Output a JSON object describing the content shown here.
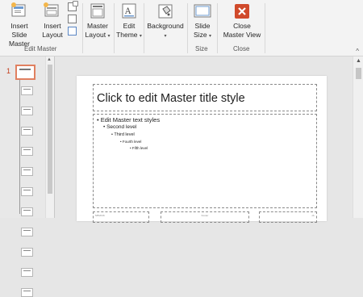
{
  "ribbon": {
    "insert_slide_master": [
      "Insert Slide",
      "Master"
    ],
    "insert_layout": [
      "Insert",
      "Layout"
    ],
    "master_layout": [
      "Master",
      "Layout"
    ],
    "edit_theme": [
      "Edit",
      "Theme"
    ],
    "background": "Background",
    "slide_size": [
      "Slide",
      "Size"
    ],
    "close_master_view": [
      "Close",
      "Master View"
    ],
    "groups": {
      "edit_master": "Edit Master",
      "size": "Size",
      "close": "Close"
    },
    "caret": "▾",
    "collapse": "^"
  },
  "thumbnails": {
    "selected_number": "1",
    "layout_count": 11
  },
  "slide": {
    "title_placeholder": "Click to edit Master title style",
    "levels": [
      "Edit Master text styles",
      "Second level",
      "Third level",
      "Fourth level",
      "Fifth level"
    ],
    "footer_date": "5/8/2016",
    "footer_text": "Footer",
    "footer_num": "‹#›"
  },
  "colors": {
    "close_red": "#d04a2b",
    "accent_orange": "#e08060"
  },
  "icons": {
    "insert_slide_master": "slide-master-icon",
    "insert_layout": "layout-icon",
    "master_layout": "master-layout-icon",
    "edit_theme": "theme-icon",
    "background": "paint-bucket-icon",
    "slide_size": "slide-size-icon",
    "close": "close-x-icon"
  }
}
